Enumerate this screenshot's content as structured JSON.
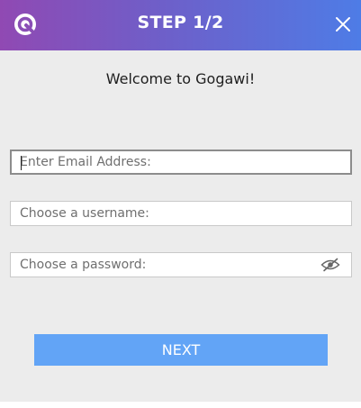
{
  "header": {
    "title": "STEP 1/2",
    "logo_icon": "gogawi-logo-icon",
    "close_icon": "close-icon"
  },
  "welcome_text": "Welcome to Gogawi!",
  "fields": {
    "email": {
      "placeholder": "Enter Email Address:",
      "value": ""
    },
    "username": {
      "placeholder": "Choose a username:",
      "value": ""
    },
    "password": {
      "placeholder": "Choose a password:",
      "value": "",
      "toggle_icon": "eye-slash-icon"
    }
  },
  "next_label": "NEXT",
  "colors": {
    "header_gradient_start": "#9049b3",
    "header_gradient_end": "#4e7ce6",
    "background": "#ececec",
    "button": "#62a4f6"
  }
}
